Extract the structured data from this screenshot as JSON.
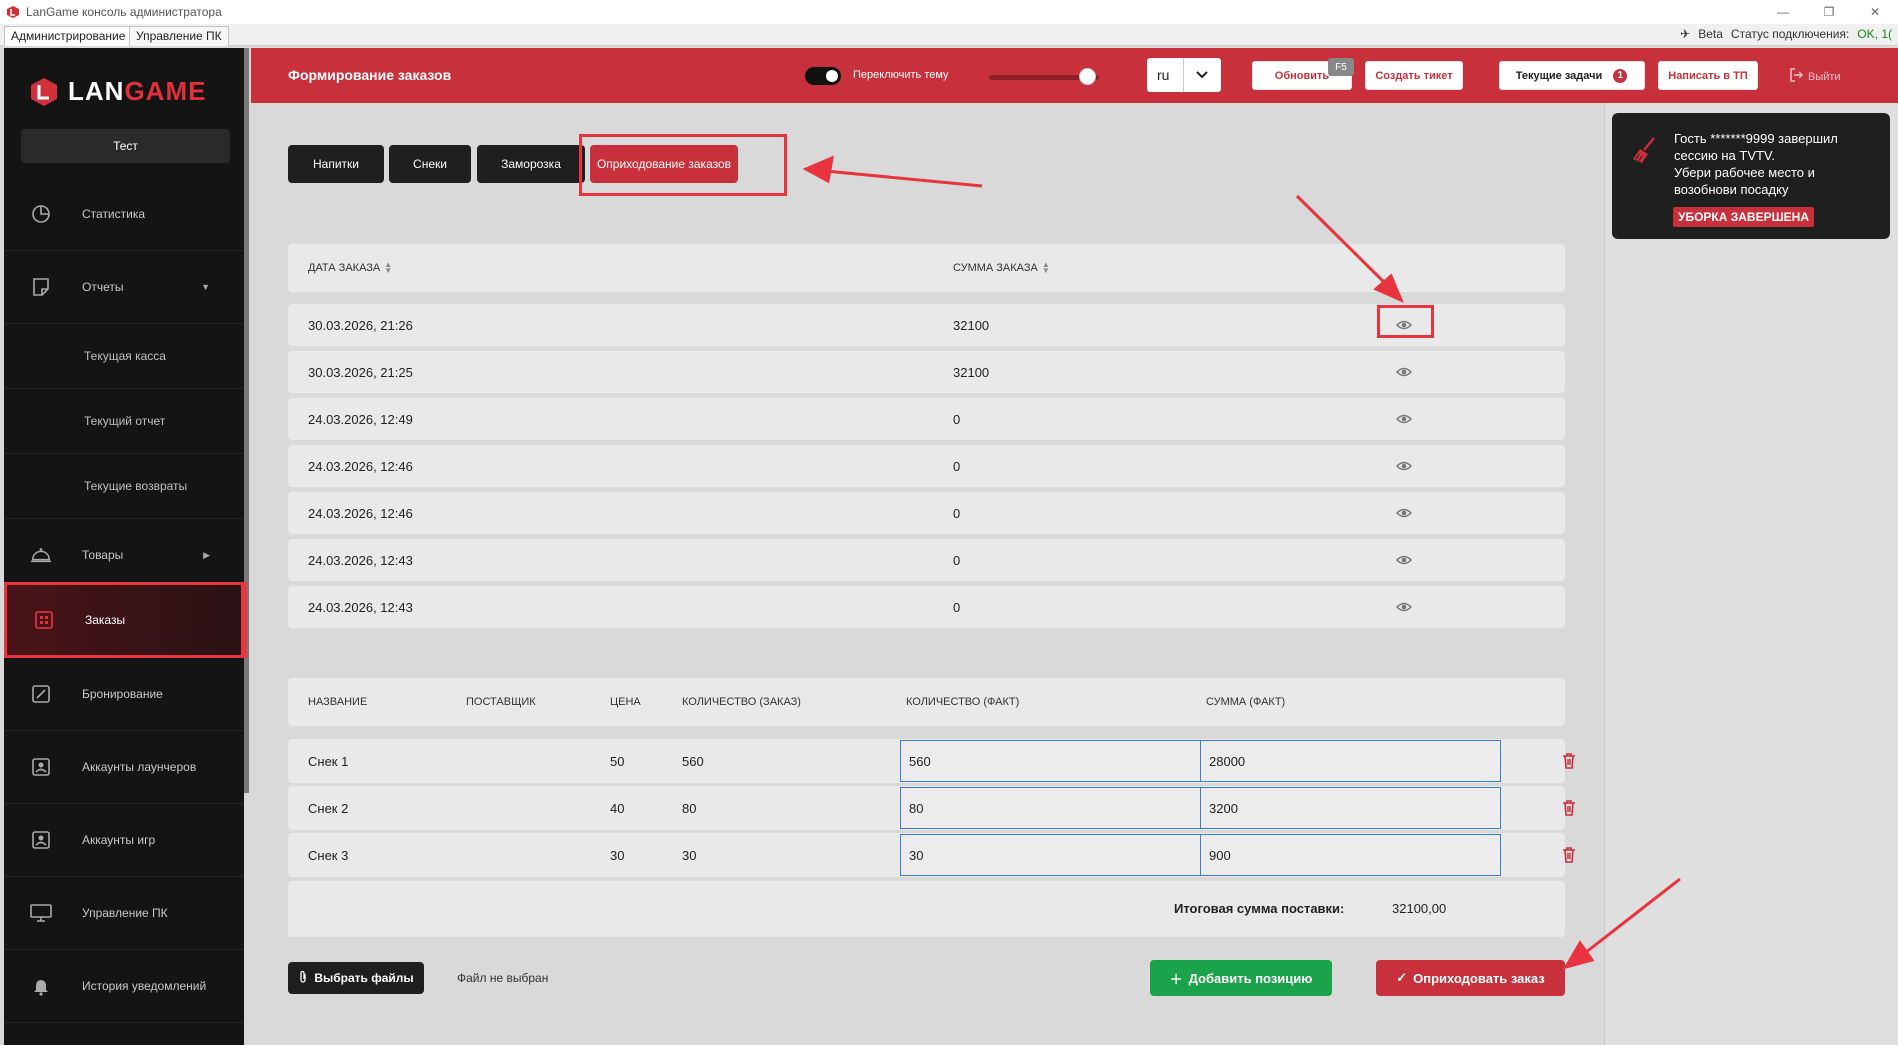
{
  "window": {
    "title": "LanGame консоль администратора"
  },
  "menubar": {
    "tabs": [
      {
        "label": "Администрирование",
        "active": true
      },
      {
        "label": "Управление ПК",
        "active": false
      }
    ],
    "beta_label": "Beta",
    "connection_label": "Статус подключения:",
    "connection_value": "OK, 1("
  },
  "sidebar": {
    "logo_lan": "LAN",
    "logo_game": "GAME",
    "club_button": "Тест",
    "items": [
      {
        "label": "Статистика",
        "icon": "chart-pie-icon"
      },
      {
        "label": "Отчеты",
        "icon": "report-icon",
        "expanded": true
      },
      {
        "label": "Текущая касса",
        "sub": true
      },
      {
        "label": "Текущий отчет",
        "sub": true
      },
      {
        "label": "Текущие возвраты",
        "sub": true
      },
      {
        "label": "Товары",
        "icon": "cloche-icon"
      },
      {
        "label": "Заказы",
        "icon": "grid-icon",
        "active": true
      },
      {
        "label": "Бронирование",
        "icon": "booking-icon"
      },
      {
        "label": "Аккаунты лаунчеров",
        "icon": "account-icon"
      },
      {
        "label": "Аккаунты игр",
        "icon": "account-icon"
      },
      {
        "label": "Управление ПК",
        "icon": "monitor-icon"
      },
      {
        "label": "История уведомлений",
        "icon": "bell-icon"
      }
    ]
  },
  "header": {
    "title": "Формирование заказов",
    "theme_toggle_label": "Переключить тему",
    "language": "ru",
    "refresh_label": "Обновить",
    "refresh_shortcut": "F5",
    "create_ticket_label": "Создать тикет",
    "current_tasks_label": "Текущие задачи",
    "current_tasks_count": "1",
    "support_label": "Написать в ТП",
    "exit_label": "Выйти"
  },
  "tabs": [
    {
      "label": "Напитки",
      "active": false
    },
    {
      "label": "Снеки",
      "active": false
    },
    {
      "label": "Заморозка",
      "active": false
    },
    {
      "label": "Оприходование заказов",
      "active": true
    }
  ],
  "orders_table": {
    "columns": [
      "ДАТА ЗАКАЗА",
      "СУММА ЗАКАЗА"
    ],
    "rows": [
      {
        "date": "30.03.2026, 21:26",
        "sum": "32100"
      },
      {
        "date": "30.03.2026, 21:25",
        "sum": "32100"
      },
      {
        "date": "24.03.2026, 12:49",
        "sum": "0"
      },
      {
        "date": "24.03.2026, 12:46",
        "sum": "0"
      },
      {
        "date": "24.03.2026, 12:46",
        "sum": "0"
      },
      {
        "date": "24.03.2026, 12:43",
        "sum": "0"
      },
      {
        "date": "24.03.2026, 12:43",
        "sum": "0"
      }
    ]
  },
  "positions_table": {
    "columns": [
      "НАЗВАНИЕ",
      "ПОСТАВЩИК",
      "ЦЕНА",
      "КОЛИЧЕСТВО (ЗАКАЗ)",
      "КОЛИЧЕСТВО (ФАКТ)",
      "СУММА (ФАКТ)"
    ],
    "rows": [
      {
        "name": "Снек 1",
        "supplier": "",
        "price": "50",
        "qty_order": "560",
        "qty_fact": "560",
        "sum_fact": "28000"
      },
      {
        "name": "Снек 2",
        "supplier": "",
        "price": "40",
        "qty_order": "80",
        "qty_fact": "80",
        "sum_fact": "3200"
      },
      {
        "name": "Снек 3",
        "supplier": "",
        "price": "30",
        "qty_order": "30",
        "qty_fact": "30",
        "sum_fact": "900"
      }
    ],
    "total_label": "Итоговая сумма поставки:",
    "total_value": "32100,00"
  },
  "footer": {
    "choose_files_label": "Выбрать файлы",
    "no_file_label": "Файл не выбран",
    "add_position_label": "Добавить позицию",
    "submit_label": "Оприходовать заказ"
  },
  "notification": {
    "lines": [
      "Гость *******9999 завершил",
      "сессию на TVTV.",
      "Убери рабочее место и",
      "возобнови посадку"
    ],
    "badge": "УБОРКА ЗАВЕРШЕНА"
  },
  "colors": {
    "accent": "#c8313c",
    "sidebar_bg": "#141414",
    "success": "#1aa34a",
    "annotation": "#e8343e"
  }
}
